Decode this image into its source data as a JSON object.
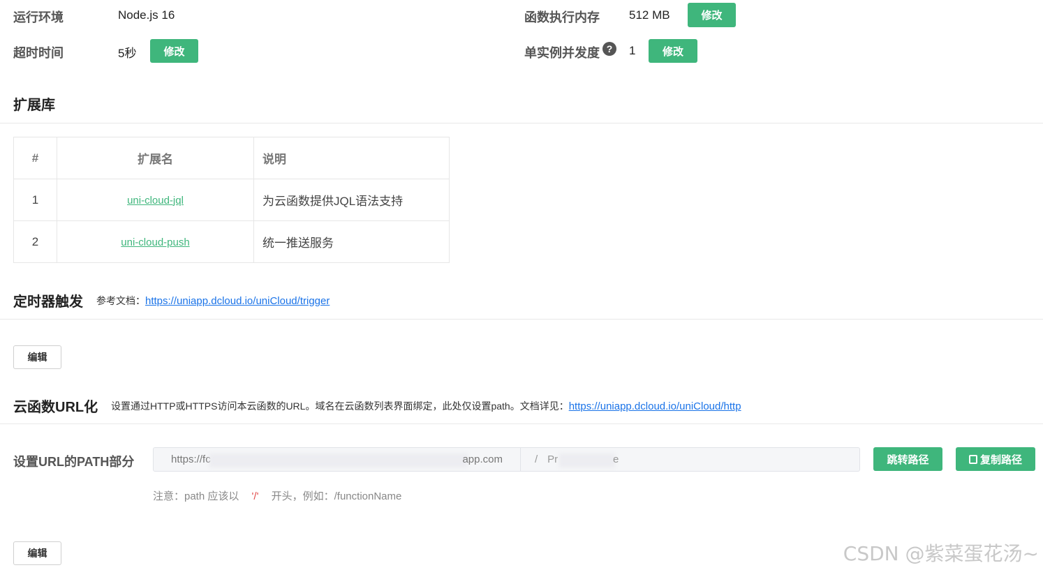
{
  "config": {
    "runtime_label": "运行环境",
    "runtime_value": "Node.js 16",
    "memory_label": "函数执行内存",
    "memory_value": "512 MB",
    "timeout_label": "超时时间",
    "timeout_value": "5秒",
    "concurrency_label": "单实例并发度",
    "concurrency_value": "1",
    "modify_label": "修改",
    "help_icon": "?"
  },
  "extensions": {
    "title": "扩展库",
    "columns": [
      "#",
      "扩展名",
      "说明"
    ],
    "rows": [
      {
        "num": "1",
        "name": "uni-cloud-jql",
        "desc": "为云函数提供JQL语法支持"
      },
      {
        "num": "2",
        "name": "uni-cloud-push",
        "desc": "统一推送服务"
      }
    ]
  },
  "timer": {
    "title": "定时器触发",
    "doc_prefix": "参考文档：",
    "doc_link": "https://uniapp.dcloud.io/uniCloud/trigger",
    "edit_label": "编辑"
  },
  "url": {
    "title": "云函数URL化",
    "desc": "设置通过HTTP或HTTPS访问本云函数的URL。域名在云函数列表界面绑定，此处仅设置path。文档详见：",
    "doc_link": "https://uniapp.dcloud.io/uniCloud/http",
    "path_label": "设置URL的PATH部分",
    "prefix_start": "https://fc",
    "prefix_end": "app.com",
    "path_slash": "/",
    "path_start": "Pr",
    "path_end": "e",
    "jump_label": "跳转路径",
    "copy_label": "复制路径",
    "note_prefix": "注意：path 应该以",
    "note_slash": "'/'",
    "note_suffix": "开头，例如：/functionName",
    "edit_label": "编辑"
  },
  "watermark": "CSDN @紫菜蛋花汤~"
}
